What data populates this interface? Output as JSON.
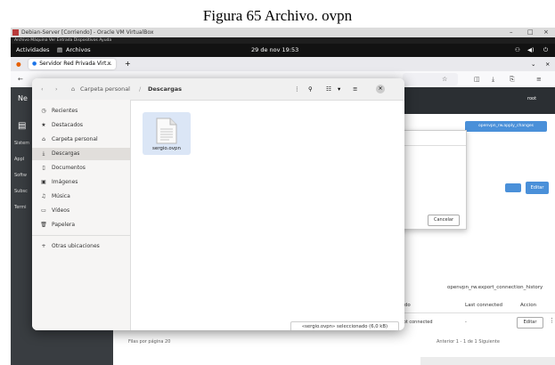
{
  "caption": "Figura 65 Archivo. ovpn",
  "vbox": {
    "title": "Debian-Server [Corriendo] - Oracle VM VirtualBox",
    "menu": "Archivo  Máquina  Ver  Entrada  Dispositivos  Ayuda",
    "win_min": "–",
    "win_max": "□",
    "win_close": "×"
  },
  "gnome": {
    "activities": "Actividades",
    "app_name": "Archivos",
    "clock": "29 de nov 19:53"
  },
  "firefox": {
    "tab_label": "Servidor Red Privada Virt…",
    "new_tab": "+",
    "back": "←"
  },
  "background_page": {
    "sidebar_items": [
      "Sistem",
      "Appl",
      "Softw",
      "Subsc",
      "Termi"
    ],
    "header_user": "root",
    "apply_button": "openvpn_rw.apply_changes",
    "edit_button": "Editar",
    "cancel_button": "Cancelar",
    "export_title": "openvpn_rw.export_connection_history",
    "columns": [
      "Estado",
      "Last connected",
      "Accion"
    ],
    "row": {
      "estado": "Not connected",
      "last": "-",
      "accion": "Editar"
    },
    "per_page": "Filas por página  20",
    "pagination": "Anterior   1 - 1 de 1   Siguiente"
  },
  "chooser": {
    "path_home": "Carpeta personal",
    "path_sep": "/",
    "path_current": "Descargas",
    "sidebar": [
      {
        "icon": "clock-icon",
        "glyph": "◷",
        "label": "Recientes"
      },
      {
        "icon": "star-icon",
        "glyph": "★",
        "label": "Destacados"
      },
      {
        "icon": "home-icon",
        "glyph": "⌂",
        "label": "Carpeta personal"
      },
      {
        "icon": "download-icon",
        "glyph": "⤓",
        "label": "Descargas"
      },
      {
        "icon": "document-icon",
        "glyph": "▯",
        "label": "Documentos"
      },
      {
        "icon": "image-icon",
        "glyph": "▣",
        "label": "Imágenes"
      },
      {
        "icon": "music-icon",
        "glyph": "♫",
        "label": "Música"
      },
      {
        "icon": "video-icon",
        "glyph": "▭",
        "label": "Vídeos"
      },
      {
        "icon": "trash-icon",
        "glyph": "🗑",
        "label": "Papelera"
      },
      {
        "icon": "plus-icon",
        "glyph": "+",
        "label": "Otras ubicaciones"
      }
    ],
    "selected_index": 3,
    "file_name": "sergio.ovpn",
    "status": "«sergio.ovpn» seleccionado (6,0 kB)"
  },
  "colors": {
    "accent": "#4a90d9",
    "dark_header": "#2b2f33",
    "sidebar_dark": "#393d41"
  }
}
